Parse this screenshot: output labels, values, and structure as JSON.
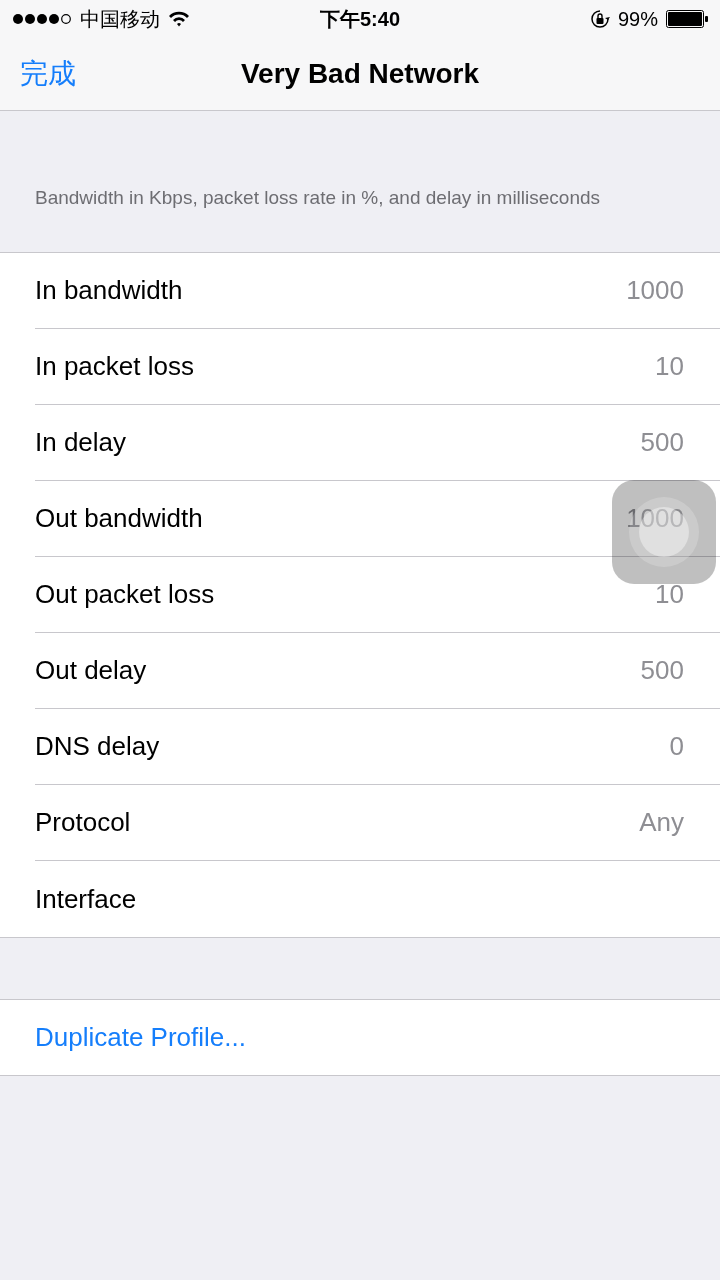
{
  "status_bar": {
    "carrier": "中国移动",
    "time": "下午5:40",
    "battery": "99%"
  },
  "nav": {
    "back": "完成",
    "title": "Very Bad Network"
  },
  "section_header": "Bandwidth in Kbps, packet loss rate in %, and delay in milliseconds",
  "rows": [
    {
      "label": "In bandwidth",
      "value": "1000"
    },
    {
      "label": "In packet loss",
      "value": "10"
    },
    {
      "label": "In delay",
      "value": "500"
    },
    {
      "label": "Out bandwidth",
      "value": "1000"
    },
    {
      "label": "Out packet loss",
      "value": "10"
    },
    {
      "label": "Out delay",
      "value": "500"
    },
    {
      "label": "DNS delay",
      "value": "0"
    },
    {
      "label": "Protocol",
      "value": "Any"
    },
    {
      "label": "Interface"
    }
  ],
  "action": "Duplicate Profile..."
}
